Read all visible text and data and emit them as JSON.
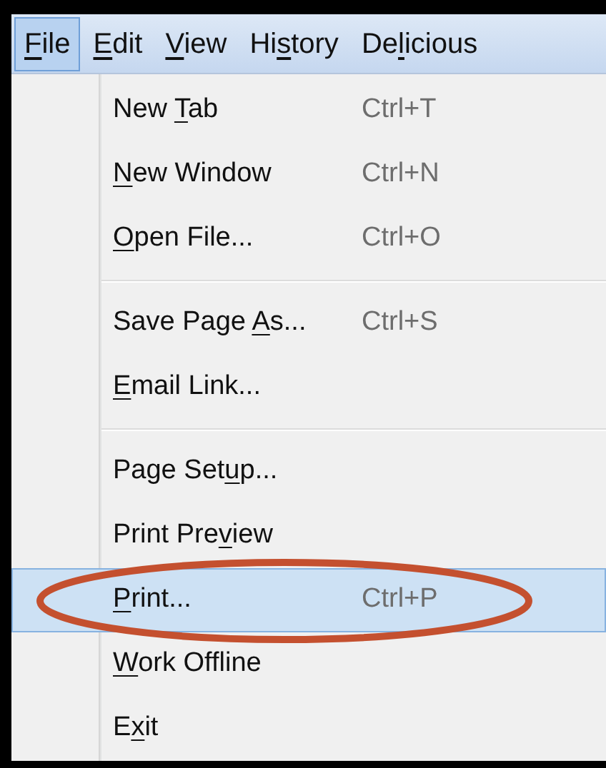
{
  "menubar": [
    {
      "key": "F",
      "post": "ile",
      "selected": true
    },
    {
      "key": "E",
      "post": "dit",
      "selected": false
    },
    {
      "key": "V",
      "post": "iew",
      "selected": false
    },
    {
      "pre": "Hi",
      "key": "s",
      "post": "tory",
      "selected": false
    },
    {
      "pre": "De",
      "key": "l",
      "post": "icious",
      "selected": false
    }
  ],
  "menu": [
    {
      "kind": "item",
      "pre": "New ",
      "key": "T",
      "post": "ab",
      "shortcut": "Ctrl+T",
      "selected": false
    },
    {
      "kind": "item",
      "key": "N",
      "post": "ew Window",
      "shortcut": "Ctrl+N",
      "selected": false
    },
    {
      "kind": "item",
      "key": "O",
      "post": "pen File...",
      "shortcut": "Ctrl+O",
      "selected": false
    },
    {
      "kind": "separator"
    },
    {
      "kind": "item",
      "pre": "Save Page ",
      "key": "A",
      "post": "s...",
      "shortcut": "Ctrl+S",
      "selected": false
    },
    {
      "kind": "item",
      "key": "E",
      "post": "mail Link...",
      "selected": false
    },
    {
      "kind": "separator"
    },
    {
      "kind": "item",
      "pre": "Page Set",
      "key": "u",
      "post": "p...",
      "selected": false
    },
    {
      "kind": "item",
      "pre": "Print Pre",
      "key": "v",
      "post": "iew",
      "selected": false
    },
    {
      "kind": "item",
      "key": "P",
      "post": "rint...",
      "shortcut": "Ctrl+P",
      "selected": true,
      "circled": true
    },
    {
      "kind": "item",
      "key": "W",
      "post": "ork Offline",
      "selected": false
    },
    {
      "kind": "item",
      "pre": "E",
      "key": "x",
      "post": "it",
      "selected": false
    }
  ]
}
